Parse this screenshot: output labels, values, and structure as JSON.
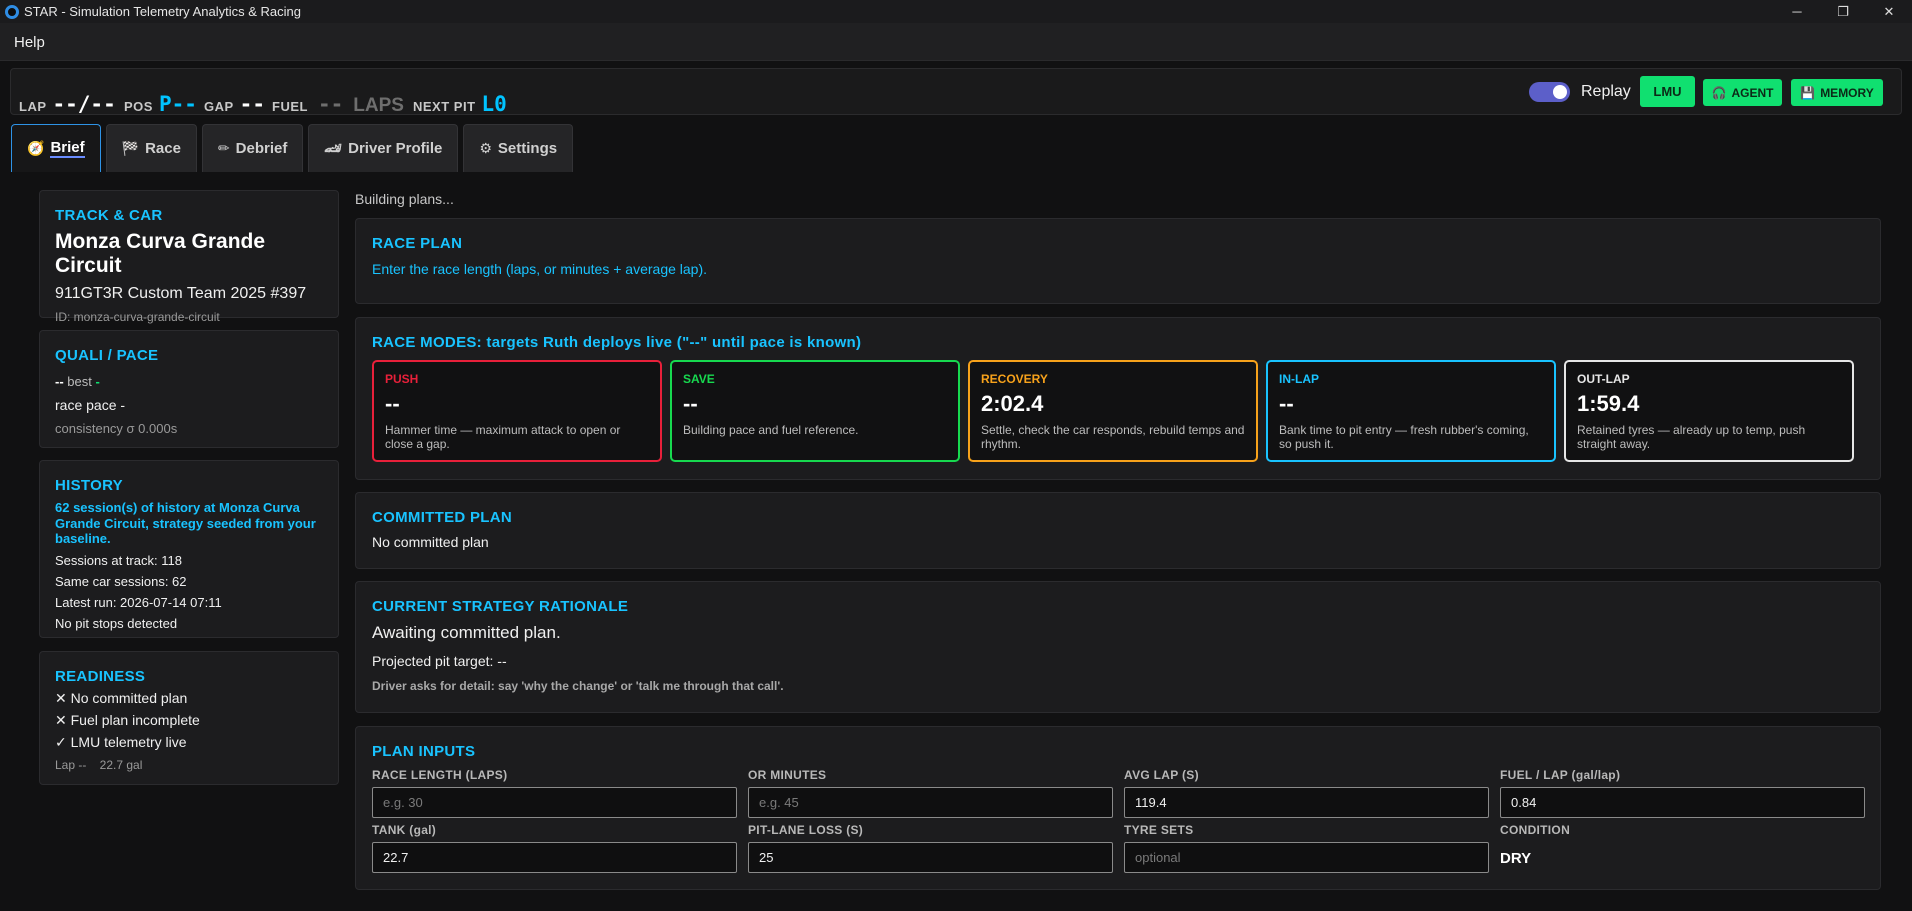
{
  "window": {
    "title": "STAR - Simulation Telemetry Analytics & Racing",
    "minimize": "─",
    "maximize": "❐",
    "close": "✕"
  },
  "menu": {
    "help": "Help"
  },
  "status": {
    "lap_label": "LAP",
    "lap_value": "--/--",
    "pos_label": "POS",
    "pos_value": "P--",
    "gap_label": "GAP",
    "gap_value": "--",
    "fuel_label": "FUEL",
    "fuel_value": "--",
    "fuel_unit": "LAPS",
    "nextpit_label": "NEXT PIT",
    "nextpit_value": "L0",
    "replay_label": "Replay",
    "lmu_button": "LMU",
    "agent_button": "AGENT",
    "memory_button": "MEMORY"
  },
  "tabs": [
    {
      "label": "Brief",
      "icon": "🧭"
    },
    {
      "label": "Race",
      "icon": "🏁"
    },
    {
      "label": "Debrief",
      "icon": "✏"
    },
    {
      "label": "Driver Profile",
      "icon": "🏎"
    },
    {
      "label": "Settings",
      "icon": "⚙"
    }
  ],
  "track_car": {
    "title": "TRACK & CAR",
    "track": "Monza Curva Grande Circuit",
    "car": "911GT3R Custom Team 2025 #397",
    "id": "ID: monza-curva-grande-circuit"
  },
  "quali": {
    "title": "QUALI / PACE",
    "best_dash": "--",
    "best_label": "best",
    "best_delta": "-",
    "race_pace": "race pace -",
    "consistency": "consistency σ 0.000s"
  },
  "history": {
    "title": "HISTORY",
    "message": "62 session(s) of history at Monza Curva Grande Circuit, strategy seeded from your baseline.",
    "sessions_track": "Sessions at track: 118",
    "same_car": "Same car sessions: 62",
    "latest_run": "Latest run: 2026-07-14 07:11",
    "pit_stops": "No pit stops detected"
  },
  "readiness": {
    "title": "READINESS",
    "items": [
      "✕ No committed plan",
      "✕ Fuel plan incomplete",
      "✓ LMU telemetry live"
    ],
    "footer": "Lap --    22.7 gal"
  },
  "building": "Building plans...",
  "race_plan": {
    "title": "RACE PLAN",
    "text": "Enter the race length (laps, or minutes + average lap)."
  },
  "race_modes": {
    "title": "RACE MODES: targets Ruth deploys live (\"--\" until pace is known)",
    "modes": [
      {
        "name": "PUSH",
        "value": "--",
        "desc": "Hammer time — maximum attack to open or close a gap.",
        "color": "#e8203a"
      },
      {
        "name": "SAVE",
        "value": "--",
        "desc": "Building pace and fuel reference.",
        "color": "#17d94f"
      },
      {
        "name": "RECOVERY",
        "value": "2:02.4",
        "desc": "Settle, check the car responds, rebuild temps and rhythm.",
        "color": "#f7a21b"
      },
      {
        "name": "IN-LAP",
        "value": "--",
        "desc": "Bank time to pit entry — fresh rubber's coming, so push it.",
        "color": "#19c3ff"
      },
      {
        "name": "OUT-LAP",
        "value": "1:59.4",
        "desc": "Retained tyres — already up to temp, push straight away.",
        "color": "#e6e6e6"
      }
    ]
  },
  "committed": {
    "title": "COMMITTED PLAN",
    "text": "No committed plan"
  },
  "rationale": {
    "title": "CURRENT STRATEGY RATIONALE",
    "awaiting": "Awaiting committed plan.",
    "pit_target": "Projected pit target: --",
    "hint": "Driver asks for detail: say 'why the change' or 'talk me through that call'."
  },
  "plan_inputs": {
    "title": "PLAN INPUTS",
    "race_length": {
      "label": "RACE LENGTH (LAPS)",
      "value": "",
      "placeholder": "e.g. 30"
    },
    "minutes": {
      "label": "OR MINUTES",
      "value": "",
      "placeholder": "e.g. 45"
    },
    "avg_lap": {
      "label": "AVG LAP (S)",
      "value": "119.4",
      "placeholder": ""
    },
    "fuel_lap": {
      "label": "FUEL / LAP (gal/lap)",
      "value": "0.84",
      "placeholder": ""
    },
    "tank": {
      "label": "TANK (gal)",
      "value": "22.7",
      "placeholder": ""
    },
    "pit_loss": {
      "label": "PIT-LANE LOSS (S)",
      "value": "25",
      "placeholder": ""
    },
    "tyre_sets": {
      "label": "TYRE SETS",
      "value": "",
      "placeholder": "optional"
    },
    "condition": {
      "label": "CONDITION",
      "value": "DRY"
    }
  }
}
